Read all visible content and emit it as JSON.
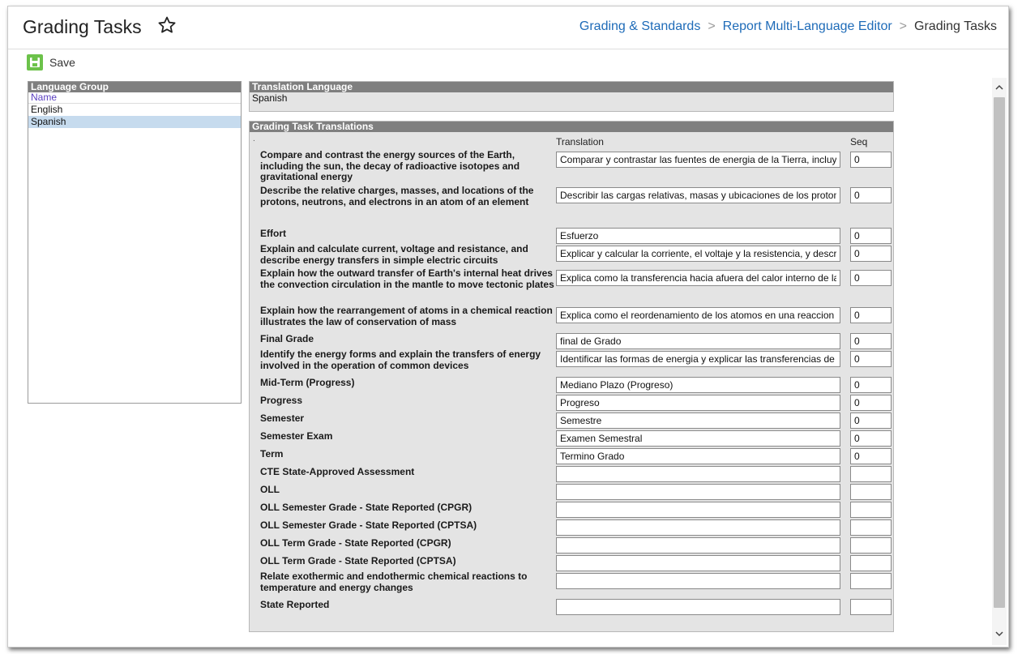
{
  "header": {
    "title": "Grading Tasks",
    "star_icon": "star-outline-icon",
    "breadcrumb": [
      "Grading & Standards",
      "Report Multi-Language Editor",
      "Grading Tasks"
    ]
  },
  "toolbar": {
    "save_label": "Save",
    "save_icon": "floppy-disk-icon",
    "accent": "#6cc24a"
  },
  "language_group": {
    "heading": "Language Group",
    "column_header": "Name",
    "items": [
      "English",
      "Spanish"
    ],
    "selected": "Spanish"
  },
  "translation_language": {
    "heading": "Translation Language",
    "value": "Spanish"
  },
  "grading_task_translations": {
    "heading": "Grading Task Translations",
    "col_translation": "Translation",
    "col_seq": "Seq",
    "dot": ".",
    "rows": [
      {
        "label": "Compare and contrast the energy sources of the Earth, including the sun, the decay of radioactive isotopes and gravitational energy",
        "translation": "Comparar y contrastar las fuentes de energia de la Tierra, incluyendo",
        "seq": "0"
      },
      {
        "label": "Describe the relative charges, masses, and locations of the protons, neutrons, and electrons in an atom of an element",
        "translation": "Describir las cargas relativas, masas y ubicaciones de los protones",
        "seq": "0"
      },
      {
        "label": "Effort",
        "translation": "Esfuerzo",
        "seq": "0"
      },
      {
        "label": "Explain and calculate current, voltage and resistance, and describe energy transfers in simple electric circuits",
        "translation": "Explicar y calcular la corriente, el voltaje y la resistencia, y describir",
        "seq": "0"
      },
      {
        "label": "Explain how the outward transfer of Earth's internal heat drives the convection circulation in the mantle to move tectonic plates",
        "translation": "Explica como la transferencia hacia afuera del calor interno de la Tierra",
        "seq": "0"
      },
      {
        "label": "Explain how the rearrangement of atoms in a chemical reaction illustrates the law of conservation of mass",
        "translation": "Explica como el reordenamiento de los atomos en una reaccion quimica",
        "seq": "0"
      },
      {
        "label": "Final Grade",
        "translation": "final de Grado",
        "seq": "0"
      },
      {
        "label": "Identify the energy forms and explain the transfers of energy involved in the operation of common devices",
        "translation": "Identificar las formas de energia y explicar las transferencias de energia",
        "seq": "0"
      },
      {
        "label": "Mid-Term (Progress)",
        "translation": "Mediano Plazo (Progreso)",
        "seq": "0"
      },
      {
        "label": "Progress",
        "translation": "Progreso",
        "seq": "0"
      },
      {
        "label": "Semester",
        "translation": "Semestre",
        "seq": "0"
      },
      {
        "label": "Semester Exam",
        "translation": "Examen Semestral",
        "seq": "0"
      },
      {
        "label": "Term",
        "translation": "Termino Grado",
        "seq": "0"
      },
      {
        "label": "CTE State-Approved Assessment",
        "translation": "",
        "seq": ""
      },
      {
        "label": "OLL",
        "translation": "",
        "seq": ""
      },
      {
        "label": "OLL Semester Grade - State Reported (CPGR)",
        "translation": "",
        "seq": ""
      },
      {
        "label": "OLL Semester Grade - State Reported (CPTSA)",
        "translation": "",
        "seq": ""
      },
      {
        "label": "OLL Term Grade - State Reported (CPGR)",
        "translation": "",
        "seq": ""
      },
      {
        "label": "OLL Term Grade - State Reported (CPTSA)",
        "translation": "",
        "seq": ""
      },
      {
        "label": "Relate exothermic and endothermic chemical reactions to temperature and energy changes",
        "translation": "",
        "seq": ""
      },
      {
        "label": "State Reported",
        "translation": "",
        "seq": ""
      }
    ]
  }
}
